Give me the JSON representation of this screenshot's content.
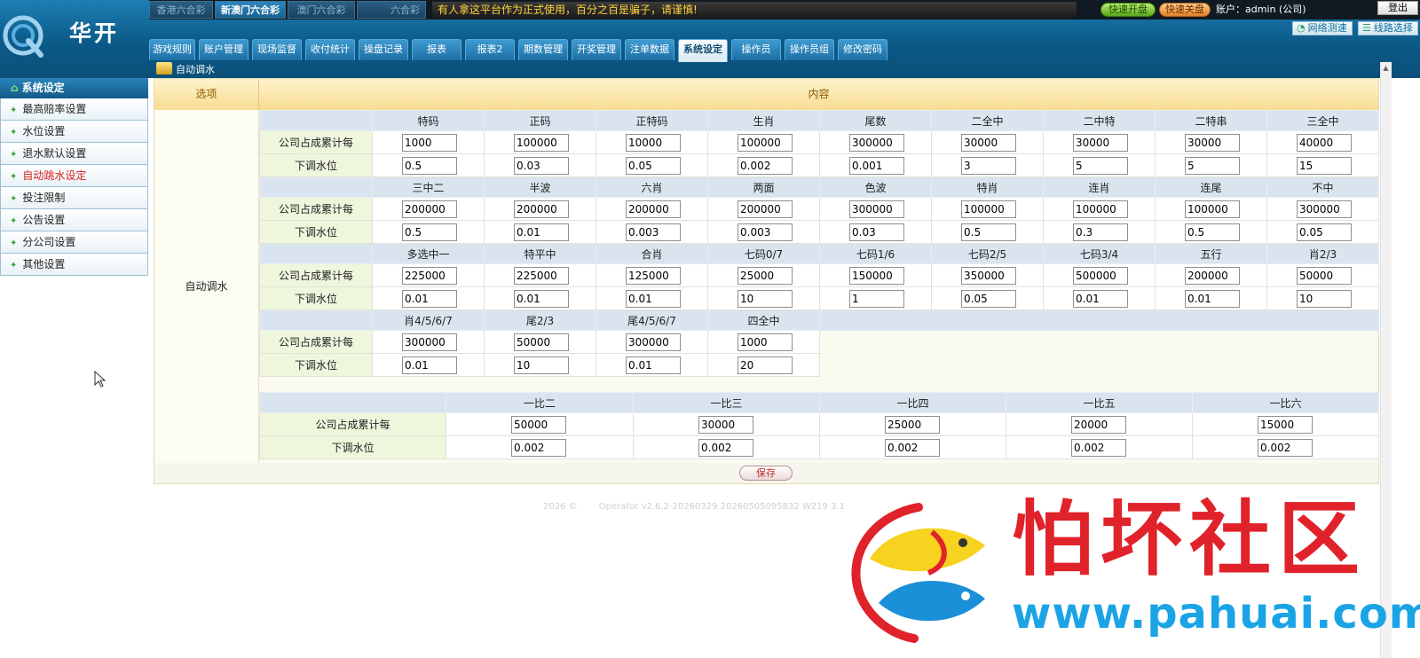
{
  "brand": {
    "name": "华开"
  },
  "lottery_tabs": [
    {
      "label": "香港六合彩",
      "active": false
    },
    {
      "label": "新澳门六合彩",
      "active": true
    },
    {
      "label": "澳门六合彩",
      "active": false
    },
    {
      "label": "六合彩",
      "active": false
    }
  ],
  "marquee": "有人拿这平台作为正式使用，百分之百是骗子，请谨慎!",
  "header_actions": {
    "quick_open": "快速开盘",
    "quick_close": "快速关盘",
    "account": "账户：admin (公司)",
    "logout": "登出",
    "network": "网络测速",
    "line": "线路选择"
  },
  "nav_tabs": [
    "游戏规则",
    "账户管理",
    "现场监督",
    "收付统计",
    "操盘记录",
    "报表",
    "报表2",
    "期数管理",
    "开奖管理",
    "注单数据",
    "系统设定",
    "操作员",
    "操作员组",
    "修改密码"
  ],
  "active_nav": "系统设定",
  "breadcrumb": "自动调水",
  "sidebar": {
    "title": "系统设定",
    "items": [
      {
        "label": "最高赔率设置",
        "active": false
      },
      {
        "label": "水位设置",
        "active": false
      },
      {
        "label": "退水默认设置",
        "active": false
      },
      {
        "label": "自动跳水设定",
        "active": true
      },
      {
        "label": "投注限制",
        "active": false
      },
      {
        "label": "公告设置",
        "active": false
      },
      {
        "label": "分公司设置",
        "active": false
      },
      {
        "label": "其他设置",
        "active": false
      }
    ]
  },
  "table": {
    "col_option": "选项",
    "col_content": "内容",
    "option_label": "自动调水",
    "row_label_amount": "公司占成累计每",
    "row_label_water": "下调水位",
    "groups": [
      {
        "headers": [
          "特码",
          "正码",
          "正特码",
          "生肖",
          "尾数",
          "二全中",
          "二中特",
          "二特串",
          "三全中"
        ],
        "amounts": [
          "1000",
          "100000",
          "10000",
          "100000",
          "300000",
          "30000",
          "30000",
          "30000",
          "40000"
        ],
        "waters": [
          "0.5",
          "0.03",
          "0.05",
          "0.002",
          "0.001",
          "3",
          "5",
          "5",
          "15"
        ]
      },
      {
        "headers": [
          "三中二",
          "半波",
          "六肖",
          "两面",
          "色波",
          "特肖",
          "连肖",
          "连尾",
          "不中"
        ],
        "amounts": [
          "200000",
          "200000",
          "200000",
          "200000",
          "300000",
          "100000",
          "100000",
          "100000",
          "300000"
        ],
        "waters": [
          "0.5",
          "0.01",
          "0.003",
          "0.003",
          "0.03",
          "0.5",
          "0.3",
          "0.5",
          "0.05"
        ]
      },
      {
        "headers": [
          "多选中一",
          "特平中",
          "合肖",
          "七码0/7",
          "七码1/6",
          "七码2/5",
          "七码3/4",
          "五行",
          "肖2/3"
        ],
        "amounts": [
          "225000",
          "225000",
          "125000",
          "25000",
          "150000",
          "350000",
          "500000",
          "200000",
          "50000"
        ],
        "waters": [
          "0.01",
          "0.01",
          "0.01",
          "10",
          "1",
          "0.05",
          "0.01",
          "0.01",
          "10"
        ]
      },
      {
        "headers": [
          "肖4/5/6/7",
          "尾2/3",
          "尾4/5/6/7",
          "四全中"
        ],
        "amounts": [
          "300000",
          "50000",
          "300000",
          "1000"
        ],
        "waters": [
          "0.01",
          "10",
          "0.01",
          "20"
        ]
      }
    ],
    "ratio_group": {
      "headers": [
        "一比二",
        "一比三",
        "一比四",
        "一比五",
        "一比六"
      ],
      "amounts": [
        "50000",
        "30000",
        "25000",
        "20000",
        "15000"
      ],
      "waters": [
        "0.002",
        "0.002",
        "0.002",
        "0.002",
        "0.002"
      ]
    },
    "save_label": "保存"
  },
  "footer": {
    "year": "2026 ©",
    "version": "Operator v2.6.2-20260329 20260505095832 W219 3.1"
  },
  "watermark": {
    "text": "怕坏社区",
    "url": "www.pahuai.com"
  }
}
